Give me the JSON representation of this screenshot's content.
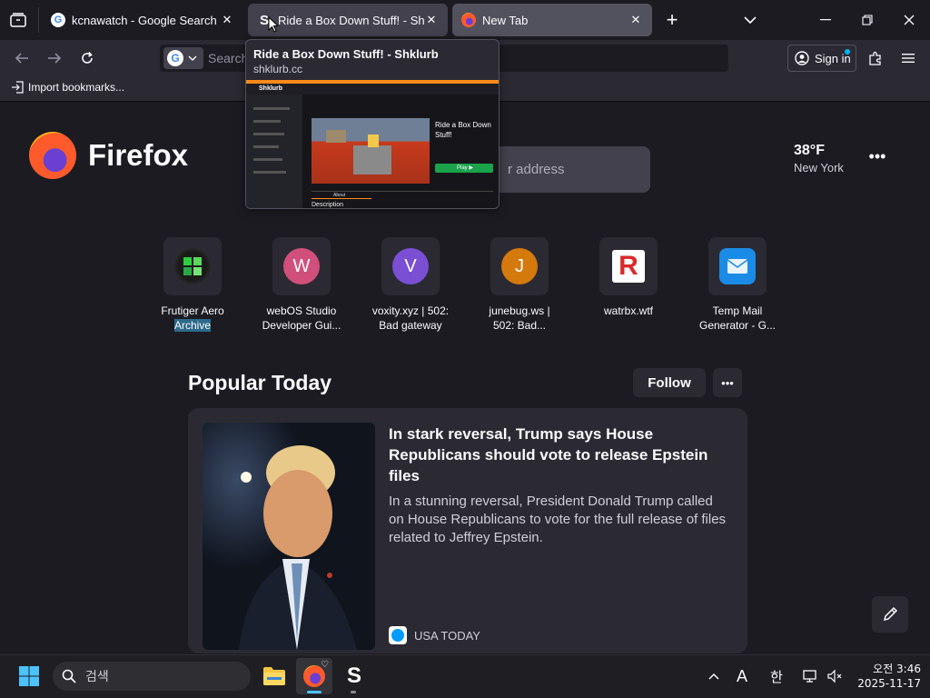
{
  "tabs": [
    {
      "title": "kcnawatch - Google Search",
      "favicon": "google-icon"
    },
    {
      "title": "Ride a Box Down Stuff! - Shk",
      "favicon": "shklurb-icon"
    },
    {
      "title": "New Tab",
      "favicon": "firefox-icon"
    }
  ],
  "tooltip": {
    "title": "Ride a Box Down Stuff! - Shklurb",
    "url": "shklurb.cc",
    "thumb": {
      "brand": "Shklurb",
      "game_title": "Ride a Box Down Stuff!",
      "play": "Play ▶",
      "tab_about": "About",
      "description": "Description"
    }
  },
  "urlbar": {
    "placeholder": "Search"
  },
  "signin": {
    "label": "Sign in"
  },
  "bookmarks": {
    "import_label": "Import bookmarks..."
  },
  "newtab": {
    "brand": "Firefox",
    "search_placeholder": "r address",
    "weather": {
      "temp": "38°F",
      "city": "New York"
    },
    "shortcuts": [
      {
        "label_line1": "Frutiger Aero",
        "label_line2": "Archive",
        "icon": "windows-orb-icon"
      },
      {
        "label_line1": "webOS Studio",
        "label_line2": "Developer Gui...",
        "letter": "W",
        "color": "#d14f7b"
      },
      {
        "label_line1": "voxity.xyz | 502:",
        "label_line2": "Bad gateway",
        "letter": "V",
        "color": "#7a4fd4"
      },
      {
        "label_line1": "junebug.ws |",
        "label_line2": "502: Bad...",
        "letter": "J",
        "color": "#d4790c"
      },
      {
        "label_line1": "watrbx.wtf",
        "label_line2": "",
        "icon": "roblox-r-icon"
      },
      {
        "label_line1": "Temp Mail",
        "label_line2": "Generator - G...",
        "icon": "mail-icon"
      }
    ],
    "popular": {
      "heading": "Popular Today",
      "follow": "Follow"
    },
    "story": {
      "headline": "In stark reversal, Trump says House Republicans should vote to release Epstein files",
      "summary": "In a stunning reversal, President Donald Trump called on House Republicans to vote for the full release of files related to Jeffrey Epstein.",
      "source": "USA TODAY"
    }
  },
  "taskbar": {
    "search_placeholder": "검색",
    "clock_time": "오전 3:46",
    "clock_date": "2025-11-17",
    "ime_lang": "한"
  }
}
